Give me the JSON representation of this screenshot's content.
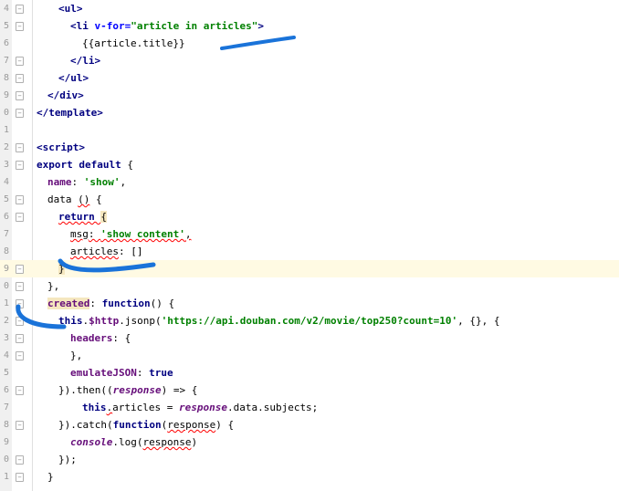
{
  "editor": {
    "lines": [
      {
        "num": "4",
        "parts": [
          {
            "t": "<ul>",
            "c": "tag"
          }
        ]
      },
      {
        "num": "5",
        "parts": [
          {
            "t": "<li ",
            "c": "tag"
          },
          {
            "t": "v-for=",
            "c": "attr"
          },
          {
            "t": "\"article in articles\"",
            "c": "str"
          },
          {
            "t": ">",
            "c": "tag"
          }
        ]
      },
      {
        "num": "6",
        "parts": [
          {
            "t": "{{article.title}}",
            "c": "plain"
          }
        ]
      },
      {
        "num": "7",
        "parts": [
          {
            "t": "</li>",
            "c": "tag"
          }
        ]
      },
      {
        "num": "8",
        "parts": [
          {
            "t": "</ul>",
            "c": "tag"
          }
        ]
      },
      {
        "num": "9",
        "parts": [
          {
            "t": "</div>",
            "c": "tag"
          }
        ]
      },
      {
        "num": "0",
        "parts": [
          {
            "t": "</template>",
            "c": "tag"
          }
        ]
      },
      {
        "num": "1",
        "parts": []
      },
      {
        "num": "2",
        "parts": [
          {
            "t": "<script>",
            "c": "tag"
          }
        ]
      },
      {
        "num": "3",
        "parts": [
          {
            "t": "export default ",
            "c": "kw"
          },
          {
            "t": "{",
            "c": "plain"
          }
        ]
      },
      {
        "num": "4",
        "parts": [
          {
            "t": "name",
            "c": "prop"
          },
          {
            "t": ": ",
            "c": "plain"
          },
          {
            "t": "'show'",
            "c": "str"
          },
          {
            "t": ",",
            "c": "plain"
          }
        ]
      },
      {
        "num": "5",
        "parts": [
          {
            "t": "data ",
            "c": "plain"
          },
          {
            "t": "()",
            "c": "plain squiggle"
          },
          {
            "t": " {",
            "c": "plain"
          }
        ]
      },
      {
        "num": "6",
        "parts": [
          {
            "t": "return ",
            "c": "kw squiggle"
          },
          {
            "t": "{",
            "c": "plain hl-sel"
          }
        ]
      },
      {
        "num": "7",
        "parts": [
          {
            "t": "msg",
            "c": "plain squiggle"
          },
          {
            "t": ": ",
            "c": "plain squiggle"
          },
          {
            "t": "'show content'",
            "c": "str squiggle"
          },
          {
            "t": ",",
            "c": "plain squiggle"
          }
        ]
      },
      {
        "num": "8",
        "parts": [
          {
            "t": "articles",
            "c": "plain squiggle"
          },
          {
            "t": ": []",
            "c": "plain"
          }
        ]
      },
      {
        "num": "9",
        "parts": [
          {
            "t": "}",
            "c": "plain hl-sel"
          }
        ]
      },
      {
        "num": "0",
        "parts": [
          {
            "t": "},",
            "c": "plain"
          }
        ]
      },
      {
        "num": "1",
        "parts": [
          {
            "t": "created",
            "c": "prop hl-sel"
          },
          {
            "t": ": ",
            "c": "plain"
          },
          {
            "t": "function",
            "c": "kw"
          },
          {
            "t": "() {",
            "c": "plain"
          }
        ]
      },
      {
        "num": "2",
        "parts": [
          {
            "t": "this",
            "c": "kw"
          },
          {
            "t": ".",
            "c": "plain"
          },
          {
            "t": "$http",
            "c": "prop"
          },
          {
            "t": ".jsonp(",
            "c": "plain"
          },
          {
            "t": "'https://api.douban.com/v2/movie/top250?count=10'",
            "c": "str"
          },
          {
            "t": ", {}, {",
            "c": "plain"
          }
        ]
      },
      {
        "num": "3",
        "parts": [
          {
            "t": "headers",
            "c": "prop"
          },
          {
            "t": ": {",
            "c": "plain"
          }
        ]
      },
      {
        "num": "4",
        "parts": [
          {
            "t": "},",
            "c": "plain"
          }
        ]
      },
      {
        "num": "5",
        "parts": [
          {
            "t": "emulateJSON",
            "c": "prop"
          },
          {
            "t": ": ",
            "c": "plain"
          },
          {
            "t": "true",
            "c": "kw"
          }
        ]
      },
      {
        "num": "6",
        "parts": [
          {
            "t": "}).",
            "c": "plain"
          },
          {
            "t": "then",
            "c": "plain"
          },
          {
            "t": "((",
            "c": "plain"
          },
          {
            "t": "response",
            "c": "italic-kw"
          },
          {
            "t": ") => {",
            "c": "plain"
          }
        ]
      },
      {
        "num": "7",
        "parts": [
          {
            "t": "this",
            "c": "kw"
          },
          {
            "t": ".",
            "c": "plain squiggle"
          },
          {
            "t": "articles = ",
            "c": "plain"
          },
          {
            "t": "response",
            "c": "italic-kw"
          },
          {
            "t": ".data.subjects;",
            "c": "plain"
          }
        ]
      },
      {
        "num": "8",
        "parts": [
          {
            "t": "})",
            "c": "plain"
          },
          {
            "t": ".catch(",
            "c": "plain"
          },
          {
            "t": "function",
            "c": "kw"
          },
          {
            "t": "(",
            "c": "plain"
          },
          {
            "t": "response",
            "c": "plain squiggle"
          },
          {
            "t": ") {",
            "c": "plain"
          }
        ]
      },
      {
        "num": "9",
        "parts": [
          {
            "t": "console",
            "c": "italic-kw"
          },
          {
            "t": ".log(",
            "c": "plain"
          },
          {
            "t": "response",
            "c": "plain squiggle"
          },
          {
            "t": ")",
            "c": "plain"
          }
        ]
      },
      {
        "num": "0",
        "parts": [
          {
            "t": "});",
            "c": "plain"
          }
        ]
      },
      {
        "num": "1",
        "parts": [
          {
            "t": "}",
            "c": "plain"
          }
        ]
      }
    ]
  },
  "colors": {
    "marker": "#1a73d9",
    "current_line": "#fffae3"
  }
}
